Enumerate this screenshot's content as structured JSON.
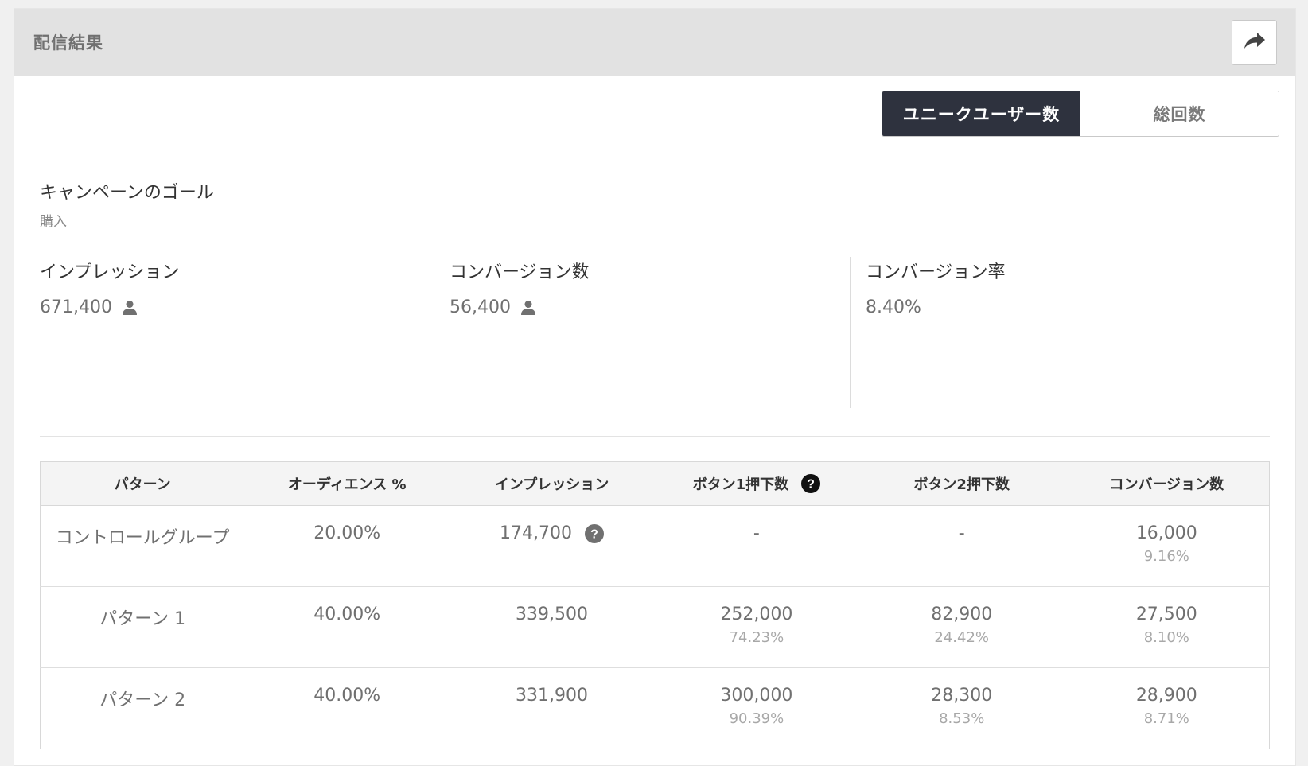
{
  "header": {
    "title": "配信結果",
    "share_icon": "share-arrow-icon"
  },
  "toggle": {
    "options": [
      {
        "label": "ユニークユーザー数",
        "active": true
      },
      {
        "label": "総回数",
        "active": false
      }
    ]
  },
  "goal": {
    "title": "キャンペーンのゴール",
    "value": "購入"
  },
  "metrics": [
    {
      "label": "インプレッション",
      "value": "671,400",
      "icon": "user-icon"
    },
    {
      "label": "コンバージョン数",
      "value": "56,400",
      "icon": "user-icon"
    },
    {
      "label": "コンバージョン率",
      "value": "8.40%"
    }
  ],
  "table": {
    "headers": [
      "パターン",
      "オーディエンス %",
      "インプレッション",
      "ボタン1押下数",
      "ボタン2押下数",
      "コンバージョン数"
    ],
    "rows": [
      {
        "pattern": "コントロールグループ",
        "audience": "20.00%",
        "impressions": "174,700",
        "button1": "-",
        "button1_pct": "",
        "button2": "-",
        "button2_pct": "",
        "conversions": "16,000",
        "conversions_pct": "9.16%"
      },
      {
        "pattern": "パターン 1",
        "audience": "40.00%",
        "impressions": "339,500",
        "button1": "252,000",
        "button1_pct": "74.23%",
        "button2": "82,900",
        "button2_pct": "24.42%",
        "conversions": "27,500",
        "conversions_pct": "8.10%"
      },
      {
        "pattern": "パターン 2",
        "audience": "40.00%",
        "impressions": "331,900",
        "button1": "300,000",
        "button1_pct": "90.39%",
        "button2": "28,300",
        "button2_pct": "8.53%",
        "conversions": "28,900",
        "conversions_pct": "8.71%"
      }
    ]
  }
}
